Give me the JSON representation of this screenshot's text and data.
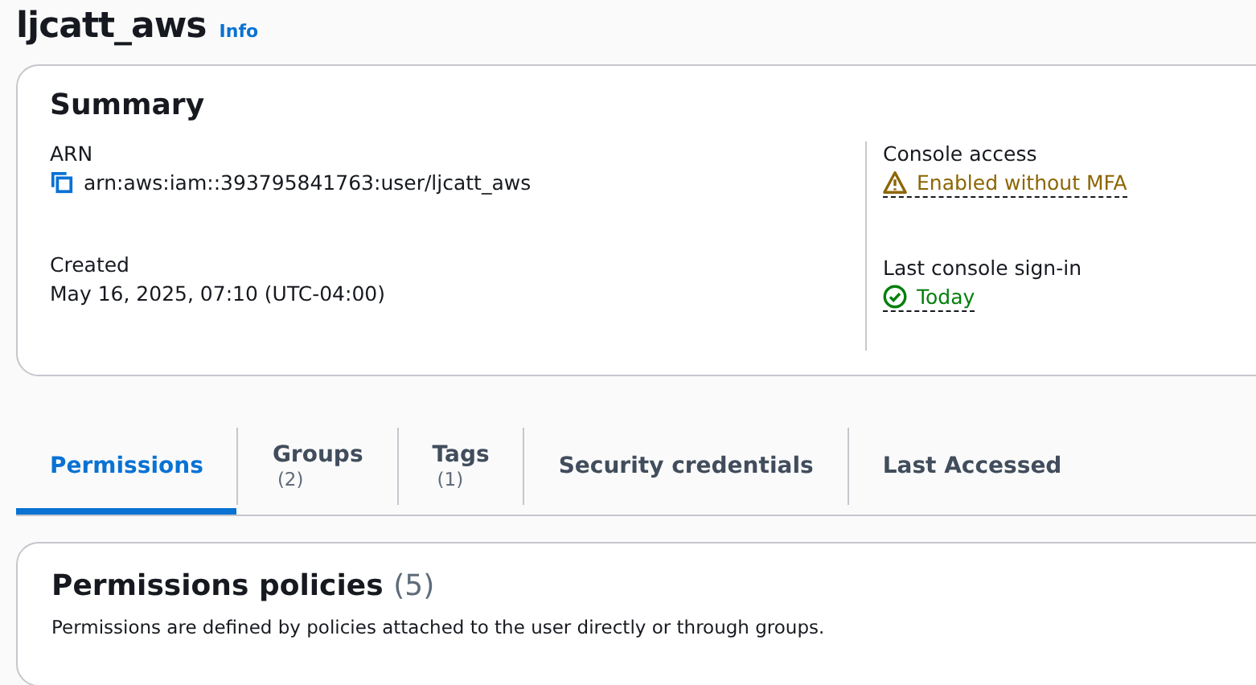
{
  "header": {
    "title": "ljcatt_aws",
    "info_link": "Info"
  },
  "summary": {
    "title": "Summary",
    "left": [
      {
        "label": "ARN",
        "value": "arn:aws:iam::393795841763:user/ljcatt_aws",
        "kind": "copy"
      },
      {
        "label": "Created",
        "value": "May 16, 2025, 07:10 (UTC-04:00)",
        "kind": "plain"
      }
    ],
    "right": [
      {
        "label": "Console access",
        "value": "Enabled without MFA",
        "kind": "warning"
      },
      {
        "label": "Last console sign-in",
        "value": "Today",
        "kind": "success"
      }
    ]
  },
  "tabs": [
    {
      "label": "Permissions",
      "selected": true
    },
    {
      "label": "Groups",
      "count": "(2)",
      "selected": false
    },
    {
      "label": "Tags",
      "count": "(1)",
      "selected": false
    },
    {
      "label": "Security credentials",
      "selected": false
    },
    {
      "label": "Last Accessed",
      "selected": false
    }
  ],
  "policies": {
    "title": "Permissions policies",
    "count": "(5)",
    "description": "Permissions are defined by policies attached to the user directly or through groups."
  }
}
